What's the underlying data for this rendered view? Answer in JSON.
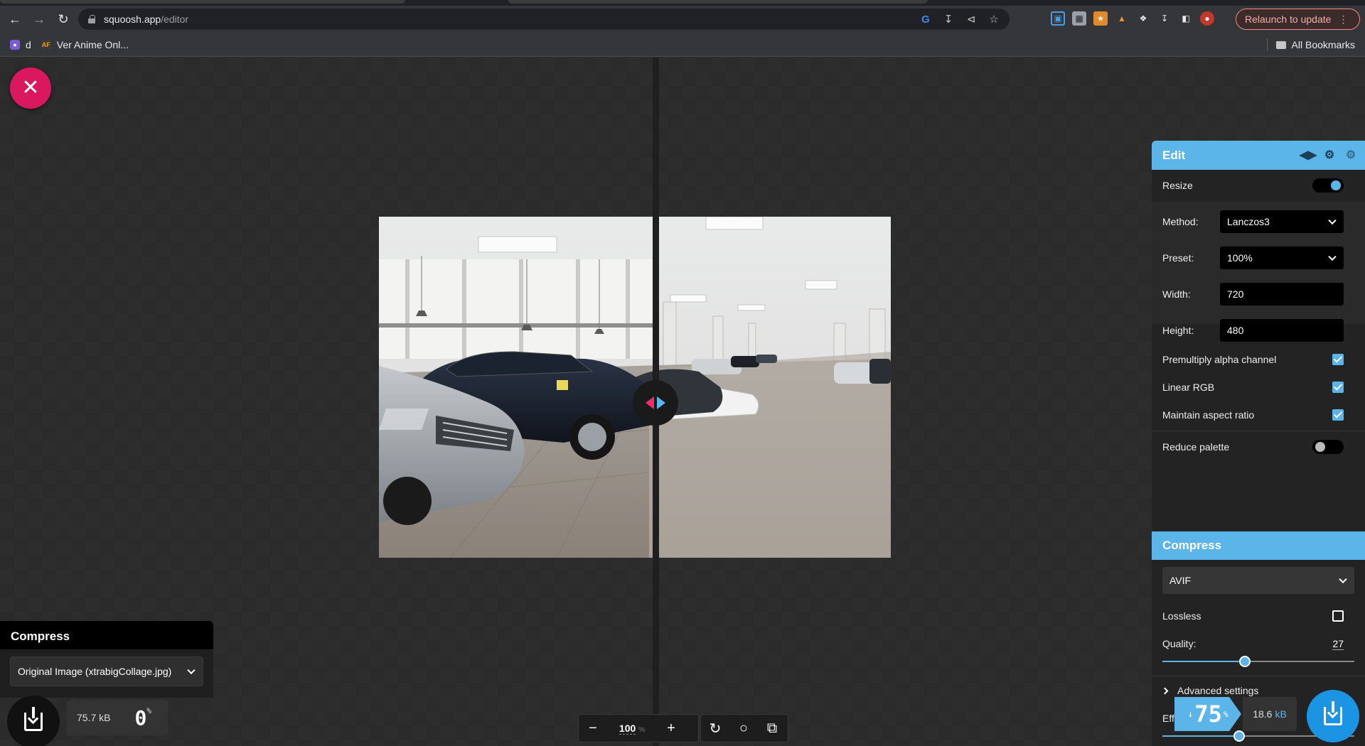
{
  "browser": {
    "url_host": "squoosh.app",
    "url_path": "/editor",
    "relaunch_label": "Relaunch to update",
    "bookmarks": [
      {
        "label": "d"
      },
      {
        "label": "Ver Anime Onl..."
      }
    ],
    "all_bookmarks_label": "All Bookmarks"
  },
  "editor": {
    "zoom_value": "100",
    "zoom_unit": "%",
    "left": {
      "title": "Compress",
      "selected_option": "Original Image (xtrabigCollage.jpg)",
      "size": "75.7 kB",
      "percent": "0",
      "percent_unit": "%"
    },
    "right": {
      "title": "Edit",
      "resize_label": "Resize",
      "resize_on": true,
      "method_label": "Method:",
      "method_value": "Lanczos3",
      "preset_label": "Preset:",
      "preset_value": "100%",
      "width_label": "Width:",
      "width_value": "720",
      "height_label": "Height:",
      "height_value": "480",
      "premultiply_label": "Premultiply alpha channel",
      "premultiply_checked": true,
      "linear_rgb_label": "Linear RGB",
      "linear_rgb_checked": true,
      "aspect_label": "Maintain aspect ratio",
      "aspect_checked": true,
      "reduce_palette_label": "Reduce palette",
      "reduce_palette_on": false,
      "compress_title": "Compress",
      "format_value": "AVIF",
      "lossless_label": "Lossless",
      "lossless_checked": false,
      "quality_label": "Quality:",
      "quality_value": "27",
      "quality_max": 63,
      "advanced_label": "Advanced settings",
      "effort_label": "Effort:",
      "effort_value": "4",
      "effort_max": 10,
      "result_percent": "75",
      "result_percent_unit": "%",
      "result_arrow": "↓",
      "result_size": "18.6",
      "result_size_unit": "kB"
    }
  },
  "colors": {
    "accent": "#5bb5e8",
    "close_button": "#d9185e",
    "scrubber_left": "#ef2d6a",
    "scrubber_right": "#57b9ee"
  }
}
